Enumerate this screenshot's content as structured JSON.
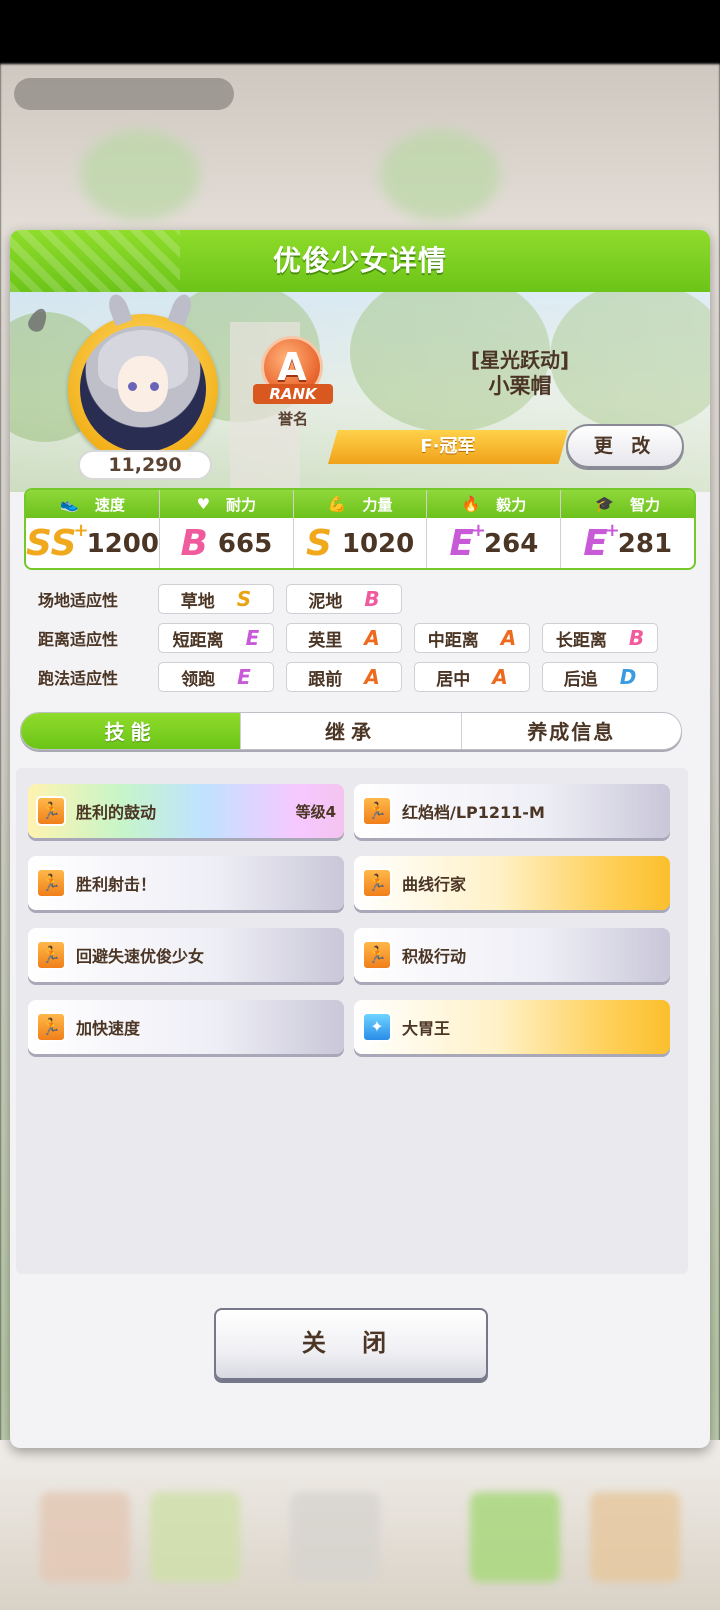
{
  "header": {
    "title": "优俊少女详情"
  },
  "profile": {
    "fans": "11,290",
    "rank_letter": "A",
    "rank_word": "RANK",
    "rank_caption": "誉名",
    "title_bracket": "[星光跃动]",
    "name": "小栗帽",
    "epithet": "F·冠军",
    "change_label": "更 改"
  },
  "stats": [
    {
      "label": "速度",
      "icon": "shoe-icon",
      "grade": "SS",
      "plus": "+",
      "value": "1200",
      "color": "#f0a81c"
    },
    {
      "label": "耐力",
      "icon": "heart-icon",
      "grade": "B",
      "plus": "",
      "value": "665",
      "color": "#ef5b9c"
    },
    {
      "label": "力量",
      "icon": "muscle-icon",
      "grade": "S",
      "plus": "",
      "value": "1020",
      "color": "#f0a81c"
    },
    {
      "label": "毅力",
      "icon": "flame-icon",
      "grade": "E",
      "plus": "+",
      "value": "264",
      "color": "#c85ad8"
    },
    {
      "label": "智力",
      "icon": "graduation-cap-icon",
      "grade": "E",
      "plus": "+",
      "value": "281",
      "color": "#c85ad8"
    }
  ],
  "aptitude": {
    "track": {
      "label": "场地适应性",
      "cells": [
        {
          "name": "草地",
          "grade": "S",
          "color": "#e8a415"
        },
        {
          "name": "泥地",
          "grade": "B",
          "color": "#ef5b9c"
        }
      ]
    },
    "distance": {
      "label": "距离适应性",
      "cells": [
        {
          "name": "短距离",
          "grade": "E",
          "color": "#c85ad8"
        },
        {
          "name": "英里",
          "grade": "A",
          "color": "#ee6a1f"
        },
        {
          "name": "中距离",
          "grade": "A",
          "color": "#ee6a1f"
        },
        {
          "name": "长距离",
          "grade": "B",
          "color": "#ef5b9c"
        }
      ]
    },
    "style": {
      "label": "跑法适应性",
      "cells": [
        {
          "name": "领跑",
          "grade": "E",
          "color": "#c85ad8"
        },
        {
          "name": "跟前",
          "grade": "A",
          "color": "#ee6a1f"
        },
        {
          "name": "居中",
          "grade": "A",
          "color": "#ee6a1f"
        },
        {
          "name": "后追",
          "grade": "D",
          "color": "#3a9ce0"
        }
      ]
    }
  },
  "tabs": [
    {
      "label": "技能"
    },
    {
      "label": "继承"
    },
    {
      "label": "养成信息"
    }
  ],
  "skills": [
    {
      "name": "胜利的鼓动",
      "level": "等级4",
      "style": "rainbow",
      "icon": "runner-icon"
    },
    {
      "name": "红焰档/LP1211-M",
      "level": "",
      "style": "white",
      "icon": "runner-icon"
    },
    {
      "name": "胜利射击！",
      "level": "",
      "style": "white",
      "icon": "runner-icon"
    },
    {
      "name": "曲线行家",
      "level": "",
      "style": "gold",
      "icon": "runner-icon"
    },
    {
      "name": "回避失速优俊少女",
      "level": "",
      "style": "white",
      "icon": "runner-icon"
    },
    {
      "name": "积极行动",
      "level": "",
      "style": "white",
      "icon": "runner-icon"
    },
    {
      "name": "加快速度",
      "level": "",
      "style": "white",
      "icon": "runner-icon"
    },
    {
      "name": "大胃王",
      "level": "",
      "style": "gold",
      "icon": "sparkle-icon"
    }
  ],
  "footer": {
    "close_label": "关 闭"
  }
}
